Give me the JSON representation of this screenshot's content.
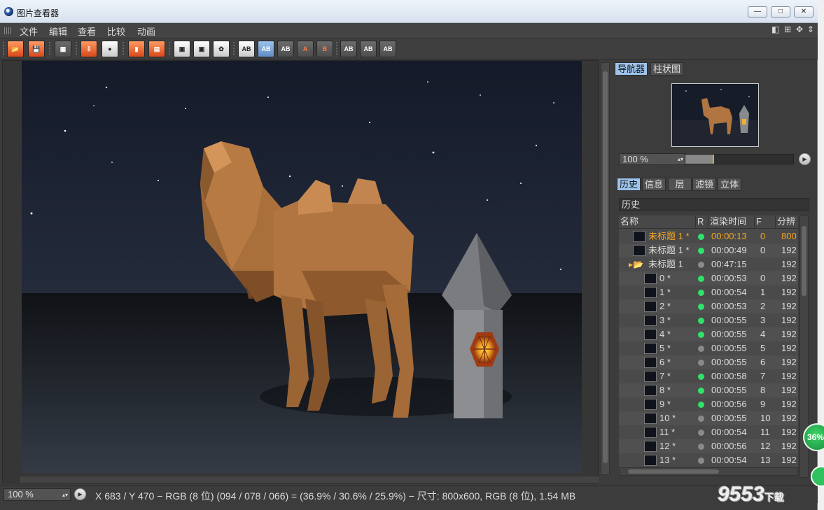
{
  "window": {
    "title": "图片查看器",
    "min_label": "—",
    "max_label": "□",
    "close_label": "✕"
  },
  "menu": {
    "items": [
      "文件",
      "编辑",
      "查看",
      "比较",
      "动画"
    ]
  },
  "toolbar": {
    "ab_label": "AB",
    "a_label": "A",
    "b_label": "B"
  },
  "navigator": {
    "tabs": [
      "导航器",
      "柱状图"
    ],
    "zoom": "100 %",
    "zoom_fraction": 0.25
  },
  "history": {
    "tabs": [
      "历史",
      "信息",
      "层",
      "滤镜",
      "立体"
    ],
    "header": "历史",
    "columns": [
      "名称",
      "R",
      "渲染时间",
      "F",
      "分辨"
    ],
    "rows": [
      {
        "name": "未标题 1 *",
        "status": "green",
        "time": "00:00:13",
        "frame": "0",
        "res": "800",
        "selected": true,
        "level": 0
      },
      {
        "name": "未标题 1 *",
        "status": "green",
        "time": "00:00:49",
        "frame": "0",
        "res": "192",
        "level": 0
      },
      {
        "name": "未标题 1",
        "status": "gray",
        "time": "00:47:15",
        "frame": "",
        "res": "192",
        "level": 0,
        "folder": true
      },
      {
        "name": "0 *",
        "status": "green",
        "time": "00:00:53",
        "frame": "0",
        "res": "192",
        "level": 1
      },
      {
        "name": "1 *",
        "status": "green",
        "time": "00:00:54",
        "frame": "1",
        "res": "192",
        "level": 1
      },
      {
        "name": "2 *",
        "status": "green",
        "time": "00:00:53",
        "frame": "2",
        "res": "192",
        "level": 1
      },
      {
        "name": "3 *",
        "status": "green",
        "time": "00:00:55",
        "frame": "3",
        "res": "192",
        "level": 1
      },
      {
        "name": "4 *",
        "status": "green",
        "time": "00:00:55",
        "frame": "4",
        "res": "192",
        "level": 1
      },
      {
        "name": "5 *",
        "status": "gray",
        "time": "00:00:55",
        "frame": "5",
        "res": "192",
        "level": 1
      },
      {
        "name": "6 *",
        "status": "gray",
        "time": "00:00:55",
        "frame": "6",
        "res": "192",
        "level": 1
      },
      {
        "name": "7 *",
        "status": "green",
        "time": "00:00:58",
        "frame": "7",
        "res": "192",
        "level": 1
      },
      {
        "name": "8 *",
        "status": "green",
        "time": "00:00:55",
        "frame": "8",
        "res": "192",
        "level": 1
      },
      {
        "name": "9 *",
        "status": "green",
        "time": "00:00:56",
        "frame": "9",
        "res": "192",
        "level": 1
      },
      {
        "name": "10 *",
        "status": "gray",
        "time": "00:00:55",
        "frame": "10",
        "res": "192",
        "level": 1
      },
      {
        "name": "11 *",
        "status": "gray",
        "time": "00:00:54",
        "frame": "11",
        "res": "192",
        "level": 1
      },
      {
        "name": "12 *",
        "status": "gray",
        "time": "00:00:56",
        "frame": "12",
        "res": "192",
        "level": 1
      },
      {
        "name": "13 *",
        "status": "gray",
        "time": "00:00:54",
        "frame": "13",
        "res": "192",
        "level": 1
      }
    ]
  },
  "status": {
    "zoom": "100 %",
    "text": "X 683 / Y 470 − RGB (8 位) (094 / 078 / 066) = (36.9% / 30.6% / 25.9%) − 尺寸: 800x600, RGB (8 位), 1.54 MB"
  },
  "overlay": {
    "badge": "36%",
    "watermark": "9553",
    "watermark_suffix": "下载"
  },
  "colors": {
    "accent": "#9ec4ee",
    "selected_text": "#f5a623",
    "status_green": "#2fe36a",
    "status_gray": "#8a8a8a"
  }
}
